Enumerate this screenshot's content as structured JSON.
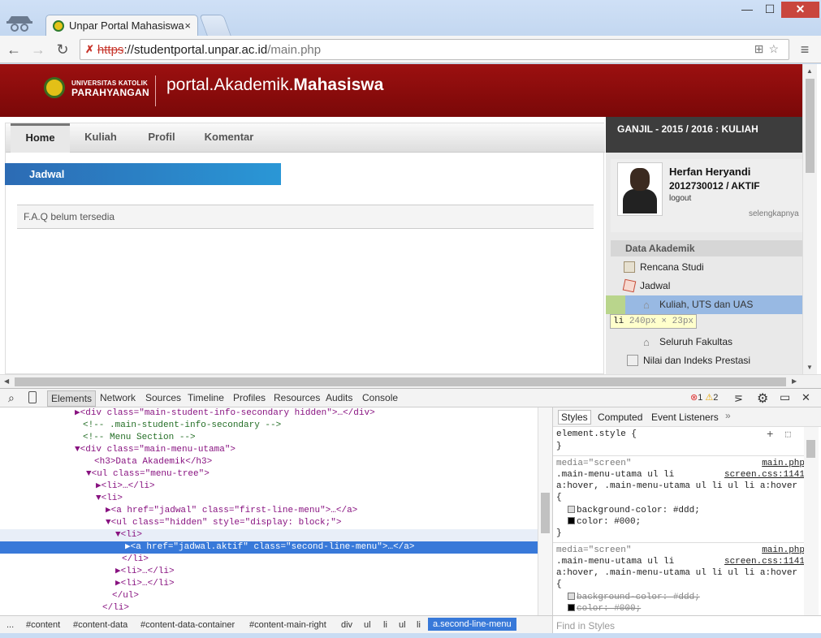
{
  "browser": {
    "tab_title": "Unpar Portal Mahasiswa",
    "tab_close": "×",
    "url_scheme": "https",
    "url_host": "://studentportal.unpar.ac.id",
    "url_path": "/main.php",
    "minimize": "—",
    "maximize": "☐",
    "close": "✕"
  },
  "site": {
    "uni_line1": "UNIVERSITAS KATOLIK",
    "uni_line2": "PARAHYANGAN",
    "portal_prefix": "portal.Akademik.",
    "portal_bold": "Mahasiswa",
    "menu": [
      "Home",
      "Kuliah",
      "Profil",
      "Komentar"
    ],
    "section_title": "Jadwal",
    "faq_text": "F.A.Q belum tersedia",
    "semester": "GANJIL - 2015 / 2016 : KULIAH",
    "student_name": "Herfan Heryandi",
    "student_npm": "2012730012 / AKTIF",
    "logout": "logout",
    "more": "selengkapnya",
    "data_akademik": "Data Akademik",
    "nav": [
      "Rencana Studi",
      "Jadwal",
      "Kuliah, UTS dan UAS",
      "Seluruh Fakultas",
      "Nilai dan Indeks Prestasi"
    ],
    "tooltip_tag": "li",
    "tooltip_dim": "240px × 23px"
  },
  "devtools": {
    "tabs": [
      "Elements",
      "Network",
      "Sources",
      "Timeline",
      "Profiles",
      "Resources",
      "Audits",
      "Console"
    ],
    "errors": "1",
    "warnings": "2",
    "style_tabs": [
      "Styles",
      "Computed",
      "Event Listeners",
      "»"
    ],
    "breadcrumbs": [
      "...",
      "#content",
      "#content-data",
      "#content-data-container",
      "#content-main-right",
      "div",
      "ul",
      "li",
      "ul",
      "li",
      "a.second-line-menu"
    ],
    "find_placeholder": "Find in Styles",
    "dom_lines": [
      "▶<div class=\"main-student-info-secondary hidden\">…</div>",
      "<!-- .main-student-info-secondary -->",
      "<!-- Menu Section -->",
      "▼<div class=\"main-menu-utama\">",
      "<h3>Data Akademik</h3>",
      "▼<ul class=\"menu-tree\">",
      "▶<li>…</li>",
      "▼<li>",
      "▶<a href=\"jadwal\" class=\"first-line-menu\">…</a>",
      "▼<ul class=\"hidden\" style=\"display: block;\">",
      "▼<li>",
      "▶<a href=\"jadwal.aktif\" class=\"second-line-menu\">…</a>",
      "</li>",
      "▶<li>…</li>",
      "▶<li>…</li>",
      "</ul>",
      "</li>"
    ],
    "style_lines": [
      "element.style {",
      "}",
      "media=\"screen\"",
      ".main-menu-utama ul li",
      "a:hover, .main-menu-utama ul li ul li a:hover",
      "{",
      "background-color: #ddd;",
      "color: #000;",
      "}",
      "media=\"screen\"",
      ".main-menu-utama ul li",
      "a:hover, .main-menu-utama ul li ul li a:hover",
      "{",
      "background-color: #ddd;",
      "color: #000;"
    ],
    "style_sources": [
      "main.php",
      "screen.css:1141",
      "main.php",
      "screen.css:1141"
    ]
  },
  "colors": {
    "header_red": "#8b0d0d",
    "accent_blue": "#2a97d6",
    "selected_row": "#3879d9"
  }
}
